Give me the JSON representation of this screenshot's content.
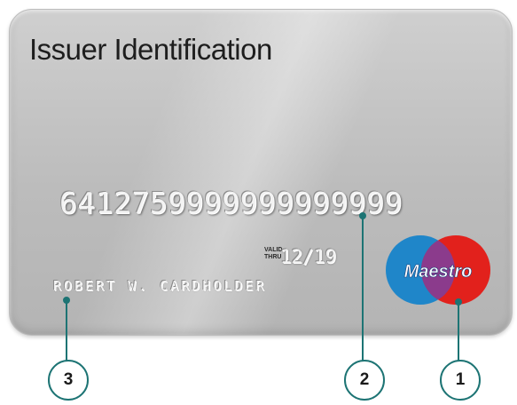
{
  "card": {
    "title": "Issuer Identification",
    "number": "6412759999999999999",
    "valid_label": "VALID THRU",
    "expiry": "12/19",
    "cardholder": "ROBERT W. CARDHOLDER",
    "brand": "Maestro",
    "logo_colors": {
      "left": "#1f86c9",
      "right": "#e2211c"
    }
  },
  "callouts": [
    {
      "label": "1",
      "target": "maestro-logo"
    },
    {
      "label": "2",
      "target": "card-number"
    },
    {
      "label": "3",
      "target": "cardholder-name"
    }
  ],
  "colors": {
    "callout_border": "#1d7474",
    "callout_line": "#1d7474"
  }
}
